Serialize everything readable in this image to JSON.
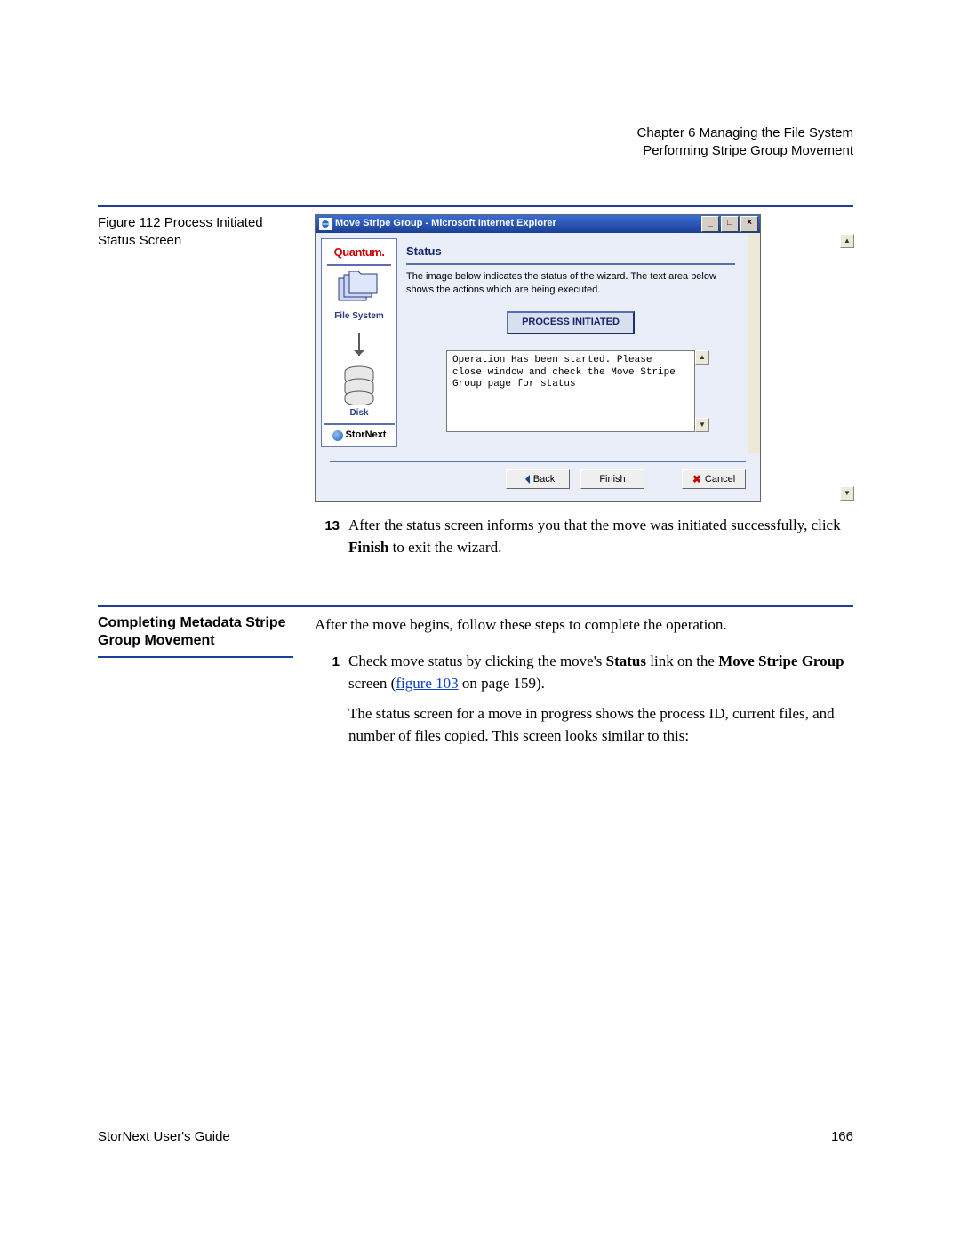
{
  "header": {
    "chapter": "Chapter 6  Managing the File System",
    "section": "Performing Stripe Group Movement"
  },
  "figure_caption": "Figure 112  Process Initiated Status Screen",
  "window": {
    "title": "Move Stripe Group - Microsoft Internet Explorer",
    "brand": "Quantum.",
    "nav_fs": "File System",
    "nav_disk": "Disk",
    "nav_product": "StorNext",
    "status_heading": "Status",
    "status_desc": "The image below indicates the status of the wizard. The text area below shows the actions which are being executed.",
    "process_btn": "PROCESS INITIATED",
    "log": "Operation Has been started. Please\nclose window and check the Move Stripe\nGroup page for status",
    "back": "Back",
    "finish": "Finish",
    "cancel": "Cancel"
  },
  "step13": {
    "num": "13",
    "text": "After the status screen informs you that the move was initiated successfully, click ",
    "bold": "Finish",
    "text2": " to exit the wizard."
  },
  "section2_heading": "Completing Metadata Stripe Group Movement",
  "section2_intro": "After the move begins, follow these steps to complete the operation.",
  "step1": {
    "num": "1",
    "t1": "Check move status by clicking the move's ",
    "b1": "Status",
    "t2": " link on the ",
    "b2": "Move Stripe Group",
    "t3": " screen (",
    "link": "figure 103",
    "t4": " on page 159).",
    "p2": "The status screen for a move in progress shows the process ID, current files, and number of files copied. This screen looks similar to this:"
  },
  "footer_left": "StorNext User's Guide",
  "footer_right": "166"
}
